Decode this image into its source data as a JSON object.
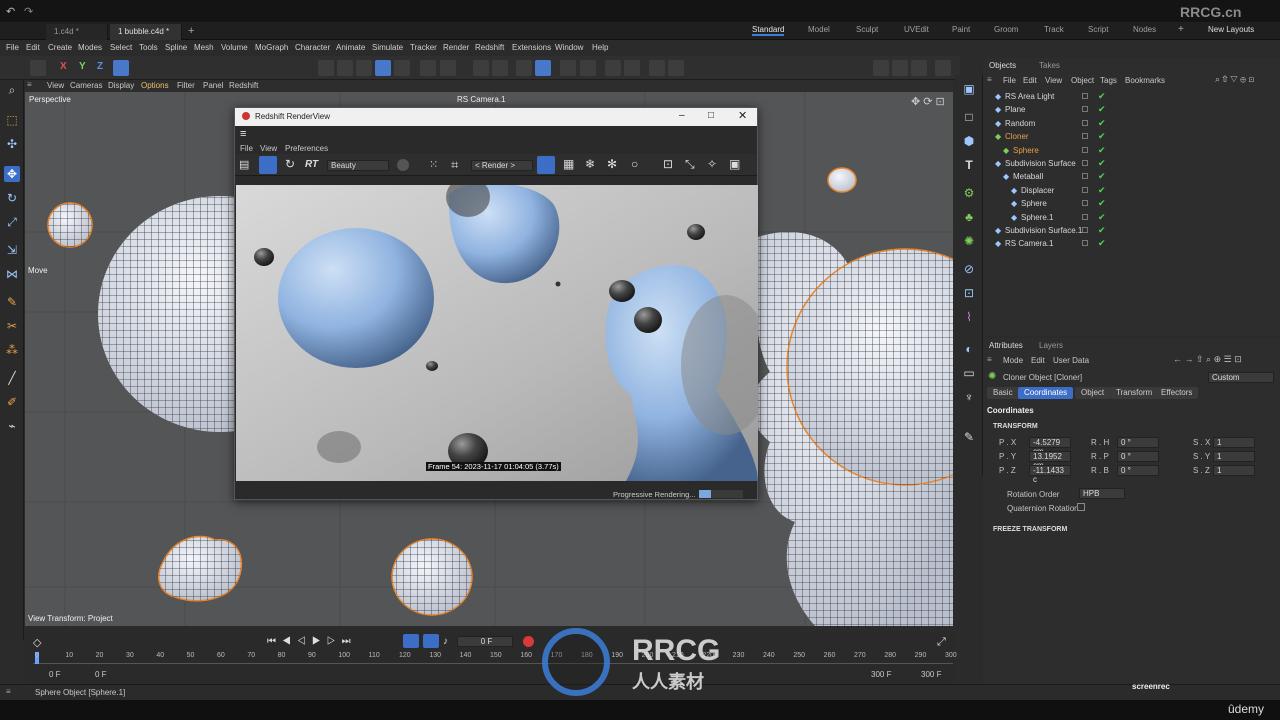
{
  "watermark": "RRCG.cn",
  "doc_tabs": [
    "1.c4d *",
    "1 bubble.c4d *"
  ],
  "layouts": [
    "Standard",
    "Model",
    "Sculpt",
    "UVEdit",
    "Paint",
    "Groom",
    "Track",
    "Script",
    "Nodes"
  ],
  "new_layouts": "New Layouts",
  "menus": [
    "File",
    "Edit",
    "Create",
    "Modes",
    "Select",
    "Tools",
    "Spline",
    "Mesh",
    "Volume",
    "MoGraph",
    "Character",
    "Animate",
    "Simulate",
    "Tracker",
    "Render",
    "Redshift",
    "Extensions",
    "Window",
    "Help"
  ],
  "axes": [
    "X",
    "Y",
    "Z"
  ],
  "viewport": {
    "menus": [
      "View",
      "Cameras",
      "Display",
      "Options",
      "Filter",
      "Panel",
      "Redshift"
    ],
    "name": "Perspective",
    "camera": "RS Camera.1",
    "transform": "View Transform: Project",
    "tool": "Move"
  },
  "render_view": {
    "title": "Redshift RenderView",
    "menus": [
      "File",
      "View",
      "Preferences"
    ],
    "rt": "RT",
    "aov": "Beauty",
    "render_btn": "< Render >",
    "frame_info": "Frame 54: 2023-11-17 01:04:05 (3.77s)",
    "status": "Progressive Rendering...",
    "progress": 0.28
  },
  "timeline": {
    "ticks": [
      "0",
      "10",
      "20",
      "30",
      "40",
      "50",
      "60",
      "70",
      "80",
      "90",
      "100",
      "110",
      "120",
      "130",
      "140",
      "150",
      "160",
      "170",
      "180",
      "190",
      "200",
      "210",
      "220",
      "230",
      "240",
      "250",
      "260",
      "270",
      "280",
      "290",
      "300"
    ],
    "current": "0 F",
    "start": "0 F",
    "start2": "0 F",
    "end": "300 F",
    "end2": "300 F"
  },
  "status_text": "Sphere Object [Sphere.1]",
  "objects": {
    "tabs": [
      "Objects",
      "Takes"
    ],
    "menus": [
      "File",
      "Edit",
      "View",
      "Object",
      "Tags",
      "Bookmarks"
    ],
    "rows": [
      {
        "name": "RS Area Light",
        "indent": 0,
        "color": "#d8d8d8"
      },
      {
        "name": "Plane",
        "indent": 0,
        "color": "#d8d8d8"
      },
      {
        "name": "Random",
        "indent": 0,
        "color": "#d8d8d8"
      },
      {
        "name": "Cloner",
        "indent": 0,
        "color": "#e8a14a"
      },
      {
        "name": "Sphere",
        "indent": 1,
        "color": "#e8a14a"
      },
      {
        "name": "Subdivision Surface",
        "indent": 0,
        "color": "#d8d8d8"
      },
      {
        "name": "Metaball",
        "indent": 1,
        "color": "#d8d8d8"
      },
      {
        "name": "Displacer",
        "indent": 2,
        "color": "#d8d8d8"
      },
      {
        "name": "Sphere",
        "indent": 2,
        "color": "#d8d8d8"
      },
      {
        "name": "Sphere.1",
        "indent": 2,
        "color": "#d8d8d8"
      },
      {
        "name": "Subdivision Surface.1",
        "indent": 0,
        "color": "#d8d8d8"
      },
      {
        "name": "RS Camera.1",
        "indent": 0,
        "color": "#d8d8d8"
      }
    ]
  },
  "attributes": {
    "tabs": [
      "Attributes",
      "Layers"
    ],
    "menus": [
      "Mode",
      "Edit",
      "User Data"
    ],
    "object_label": "Cloner Object [Cloner]",
    "preset": "Custom",
    "buttons": [
      "Basic",
      "Coordinates",
      "Object",
      "Transform",
      "Effectors"
    ],
    "section": "Coordinates",
    "transform_label": "TRANSFORM",
    "rows": [
      {
        "p": "P . X",
        "pv": "-4.5279 cm",
        "r": "R . H",
        "rv": "0 °",
        "s": "S . X",
        "sv": "1"
      },
      {
        "p": "P . Y",
        "pv": "13.1952 cm",
        "r": "R . P",
        "rv": "0 °",
        "s": "S . Y",
        "sv": "1"
      },
      {
        "p": "P . Z",
        "pv": "-11.1433 c",
        "r": "R . B",
        "rv": "0 °",
        "s": "S . Z",
        "sv": "1"
      }
    ],
    "rotation_order_label": "Rotation Order",
    "rotation_order": "HPB",
    "quaternion_label": "Quaternion Rotation",
    "freeze_label": "FREEZE TRANSFORM"
  },
  "brand": {
    "rrcg": "RRCG",
    "sub": "人人素材",
    "screenrec": "screenrec",
    "udemy": "ûdemy"
  }
}
